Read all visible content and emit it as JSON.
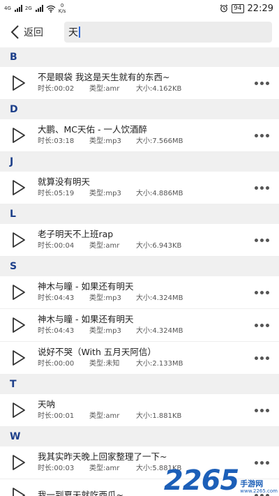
{
  "status_bar": {
    "sig1_top": "4G",
    "sig1_bottom": "2G",
    "speed_value": "0",
    "speed_unit": "K/s",
    "battery": "94",
    "time": "22:29"
  },
  "header": {
    "back_label": "返回",
    "search_value": "天"
  },
  "sections": [
    {
      "letter": "B",
      "items": [
        {
          "title": "不是眼袋 我这是天生就有的东西~",
          "duration": "时长:00:02",
          "type": "类型:amr",
          "size": "大小:4.162KB"
        }
      ]
    },
    {
      "letter": "D",
      "items": [
        {
          "title": "大鹏、MC天佑 - 一人饮酒醉",
          "duration": "时长:03:18",
          "type": "类型:mp3",
          "size": "大小:7.566MB"
        }
      ]
    },
    {
      "letter": "J",
      "items": [
        {
          "title": "就算没有明天",
          "duration": "时长:05:19",
          "type": "类型:mp3",
          "size": "大小:4.886MB"
        }
      ]
    },
    {
      "letter": "L",
      "items": [
        {
          "title": "老子明天不上班rap",
          "duration": "时长:00:04",
          "type": "类型:amr",
          "size": "大小:6.943KB"
        }
      ]
    },
    {
      "letter": "S",
      "items": [
        {
          "title": "神木与瞳 - 如果还有明天",
          "duration": "时长:04:43",
          "type": "类型:mp3",
          "size": "大小:4.324MB"
        },
        {
          "title": "神木与瞳 - 如果还有明天",
          "duration": "时长:04:43",
          "type": "类型:mp3",
          "size": "大小:4.324MB"
        },
        {
          "title": "说好不哭（With 五月天阿信）",
          "duration": "时长:00:00",
          "type": "类型:未知",
          "size": "大小:2.133MB"
        }
      ]
    },
    {
      "letter": "T",
      "items": [
        {
          "title": "天呐",
          "duration": "时长:00:01",
          "type": "类型:amr",
          "size": "大小:1.881KB"
        }
      ]
    },
    {
      "letter": "W",
      "items": [
        {
          "title": "我其实昨天晚上回家整理了一下~",
          "duration": "时长:00:03",
          "type": "类型:amr",
          "size": "大小:5.881KB"
        },
        {
          "title": "我一到夏天就吃西瓜~",
          "duration": "",
          "type": "",
          "size": ""
        }
      ]
    }
  ],
  "watermark": {
    "number": "2265",
    "text": "手游网",
    "url": "www.2265.com"
  },
  "colors": {
    "section_letter": "#1d3f8a",
    "section_bg": "#f0f0f0",
    "search_bg": "#ececec",
    "caret": "#2a66d8"
  }
}
